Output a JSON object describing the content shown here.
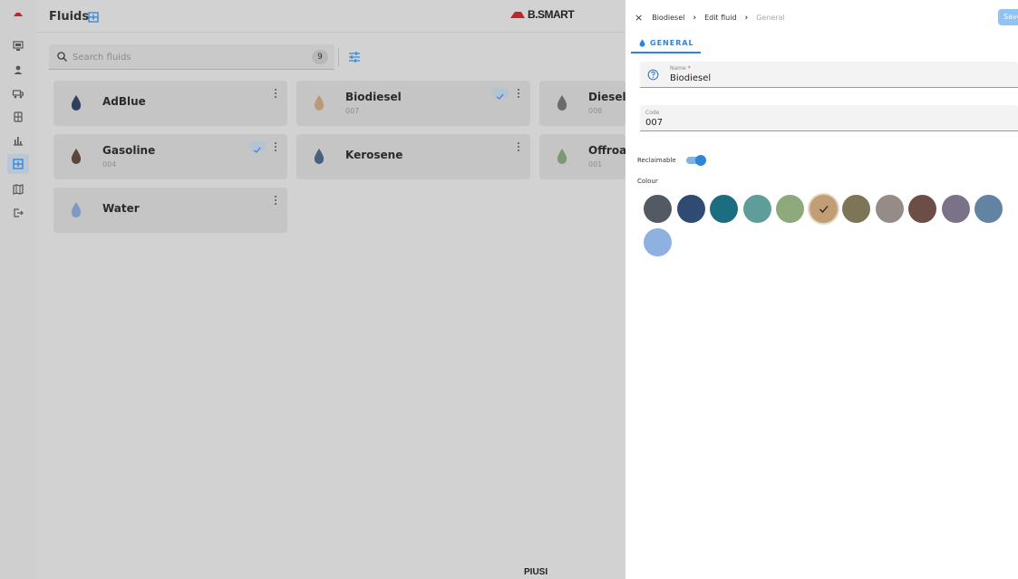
{
  "rail": {
    "items": [
      {
        "icon": "dashboard-icon"
      },
      {
        "icon": "user-icon"
      },
      {
        "icon": "vehicle-icon"
      },
      {
        "icon": "tank-icon"
      },
      {
        "icon": "reports-icon"
      },
      {
        "icon": "fluids-icon",
        "active": true
      },
      {
        "icon": "map-icon"
      },
      {
        "icon": "logout-icon"
      }
    ]
  },
  "header": {
    "title": "Fluids",
    "brand": "B.SMART"
  },
  "search": {
    "placeholder": "Search fluids",
    "count": "9"
  },
  "fluids": [
    {
      "name": "AdBlue",
      "code": "",
      "color": "#2f3f5f"
    },
    {
      "name": "Biodiesel",
      "code": "007",
      "color": "#b89a78",
      "badge": true
    },
    {
      "name": "Diesel",
      "code": "008",
      "color": "#6b6b6b"
    },
    {
      "name": "Gasoline",
      "code": "004",
      "color": "#5c4639",
      "badge": true
    },
    {
      "name": "Kerosene",
      "code": "",
      "color": "#4a5f7a"
    },
    {
      "name": "Offroa",
      "code": "001",
      "color": "#7c9a72"
    },
    {
      "name": "Water",
      "code": "",
      "color": "#7f99c6"
    }
  ],
  "footer": {
    "brand": "PIUSI"
  },
  "panel": {
    "close": "×",
    "breadcrumbs": [
      "Biodiesel",
      "Edit fluid",
      "General"
    ],
    "save_label": "Save",
    "tab_label": "GENERAL",
    "name_label": "Name",
    "name_required": "*",
    "name_value": "Biodiesel",
    "code_label": "Code",
    "code_value": "007",
    "reclaimable_label": "Reclaimable",
    "reclaimable_on": true,
    "colour_label": "Colour",
    "colours": [
      "#535a64",
      "#2f4a73",
      "#1b6e80",
      "#5f9d9b",
      "#8eaa7d",
      "#c19e76",
      "#7d7558",
      "#958c87",
      "#6c4e47",
      "#7a7387",
      "#6383a3",
      "#8fb1e2"
    ],
    "selected_colour_index": 5
  },
  "accent": "#2f86d9"
}
